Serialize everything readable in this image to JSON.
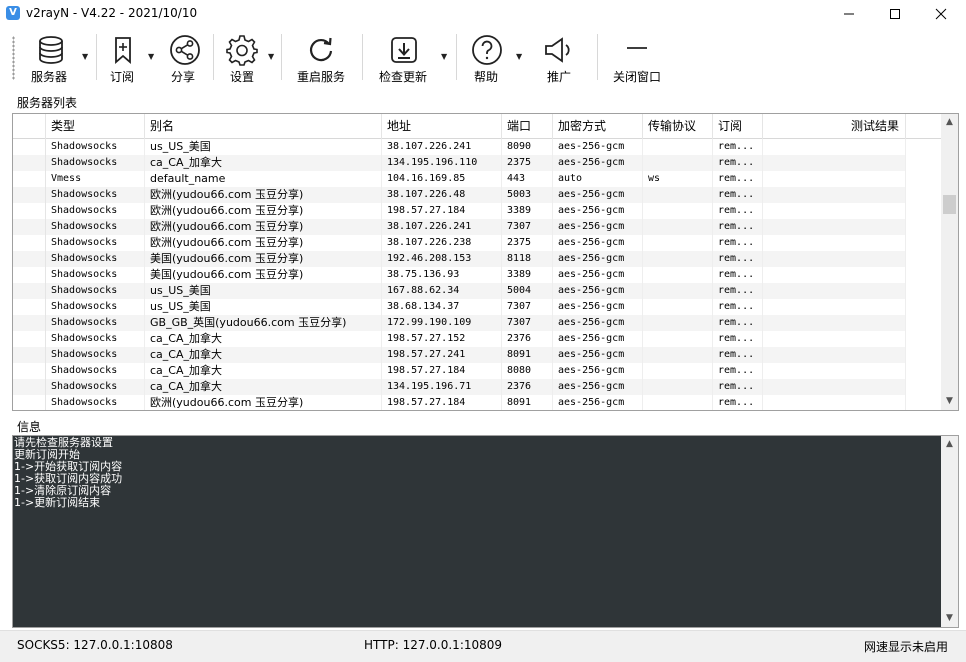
{
  "window": {
    "title": "v2rayN - V4.22 - 2021/10/10",
    "icon_letter": "V",
    "minimize_glyph": "—",
    "maximize_glyph": "☐",
    "close_glyph": "✕"
  },
  "toolbar": {
    "servers": "服务器",
    "subscription": "订阅",
    "share": "分享",
    "settings": "设置",
    "restart_service": "重启服务",
    "check_update": "检查更新",
    "help": "帮助",
    "promotion": "推广",
    "close_window": "关闭窗口"
  },
  "server_list": {
    "label": "服务器列表",
    "columns": {
      "type": "类型",
      "alias": "别名",
      "address": "地址",
      "port": "端口",
      "encryption": "加密方式",
      "transport": "传输协议",
      "subscription": "订阅",
      "test_result": "测试结果"
    },
    "rows": [
      {
        "type": "Shadowsocks",
        "alias": "us_US_美国",
        "address": "38.107.226.241",
        "port": "8090",
        "encryption": "aes-256-gcm",
        "transport": "",
        "subscription": "rem..."
      },
      {
        "type": "Shadowsocks",
        "alias": "ca_CA_加拿大",
        "address": "134.195.196.110",
        "port": "2375",
        "encryption": "aes-256-gcm",
        "transport": "",
        "subscription": "rem..."
      },
      {
        "type": "Vmess",
        "alias": "default_name",
        "address": "104.16.169.85",
        "port": "443",
        "encryption": "auto",
        "transport": "ws",
        "subscription": "rem..."
      },
      {
        "type": "Shadowsocks",
        "alias": "欧洲(yudou66.com 玉豆分享)",
        "address": "38.107.226.48",
        "port": "5003",
        "encryption": "aes-256-gcm",
        "transport": "",
        "subscription": "rem..."
      },
      {
        "type": "Shadowsocks",
        "alias": "欧洲(yudou66.com 玉豆分享)",
        "address": "198.57.27.184",
        "port": "3389",
        "encryption": "aes-256-gcm",
        "transport": "",
        "subscription": "rem..."
      },
      {
        "type": "Shadowsocks",
        "alias": "欧洲(yudou66.com 玉豆分享)",
        "address": "38.107.226.241",
        "port": "7307",
        "encryption": "aes-256-gcm",
        "transport": "",
        "subscription": "rem..."
      },
      {
        "type": "Shadowsocks",
        "alias": "欧洲(yudou66.com 玉豆分享)",
        "address": "38.107.226.238",
        "port": "2375",
        "encryption": "aes-256-gcm",
        "transport": "",
        "subscription": "rem..."
      },
      {
        "type": "Shadowsocks",
        "alias": "美国(yudou66.com 玉豆分享)",
        "address": "192.46.208.153",
        "port": "8118",
        "encryption": "aes-256-gcm",
        "transport": "",
        "subscription": "rem..."
      },
      {
        "type": "Shadowsocks",
        "alias": "美国(yudou66.com 玉豆分享)",
        "address": "38.75.136.93",
        "port": "3389",
        "encryption": "aes-256-gcm",
        "transport": "",
        "subscription": "rem..."
      },
      {
        "type": "Shadowsocks",
        "alias": "us_US_美国",
        "address": "167.88.62.34",
        "port": "5004",
        "encryption": "aes-256-gcm",
        "transport": "",
        "subscription": "rem..."
      },
      {
        "type": "Shadowsocks",
        "alias": "us_US_美国",
        "address": "38.68.134.37",
        "port": "7307",
        "encryption": "aes-256-gcm",
        "transport": "",
        "subscription": "rem..."
      },
      {
        "type": "Shadowsocks",
        "alias": "GB_GB_英国(yudou66.com 玉豆分享)",
        "address": "172.99.190.109",
        "port": "7307",
        "encryption": "aes-256-gcm",
        "transport": "",
        "subscription": "rem..."
      },
      {
        "type": "Shadowsocks",
        "alias": "ca_CA_加拿大",
        "address": "198.57.27.152",
        "port": "2376",
        "encryption": "aes-256-gcm",
        "transport": "",
        "subscription": "rem..."
      },
      {
        "type": "Shadowsocks",
        "alias": "ca_CA_加拿大",
        "address": "198.57.27.241",
        "port": "8091",
        "encryption": "aes-256-gcm",
        "transport": "",
        "subscription": "rem..."
      },
      {
        "type": "Shadowsocks",
        "alias": "ca_CA_加拿大",
        "address": "198.57.27.184",
        "port": "8080",
        "encryption": "aes-256-gcm",
        "transport": "",
        "subscription": "rem..."
      },
      {
        "type": "Shadowsocks",
        "alias": "ca_CA_加拿大",
        "address": "134.195.196.71",
        "port": "2376",
        "encryption": "aes-256-gcm",
        "transport": "",
        "subscription": "rem..."
      },
      {
        "type": "Shadowsocks",
        "alias": "欧洲(yudou66.com 玉豆分享)",
        "address": "198.57.27.184",
        "port": "8091",
        "encryption": "aes-256-gcm",
        "transport": "",
        "subscription": "rem..."
      }
    ]
  },
  "info": {
    "label": "信息",
    "lines": [
      "请先检查服务器设置",
      "更新订阅开始",
      "1->开始获取订阅内容",
      "1->获取订阅内容成功",
      "1->清除原订阅内容",
      "1->更新订阅结束"
    ]
  },
  "status": {
    "socks": "SOCKS5:  127.0.0.1:10808",
    "http": "HTTP:  127.0.0.1:10809",
    "speed": "网速显示未启用"
  },
  "colors": {
    "log_bg": "#2f3538",
    "log_text": "#ffffff",
    "icon_accent": "#3a8ee6"
  }
}
